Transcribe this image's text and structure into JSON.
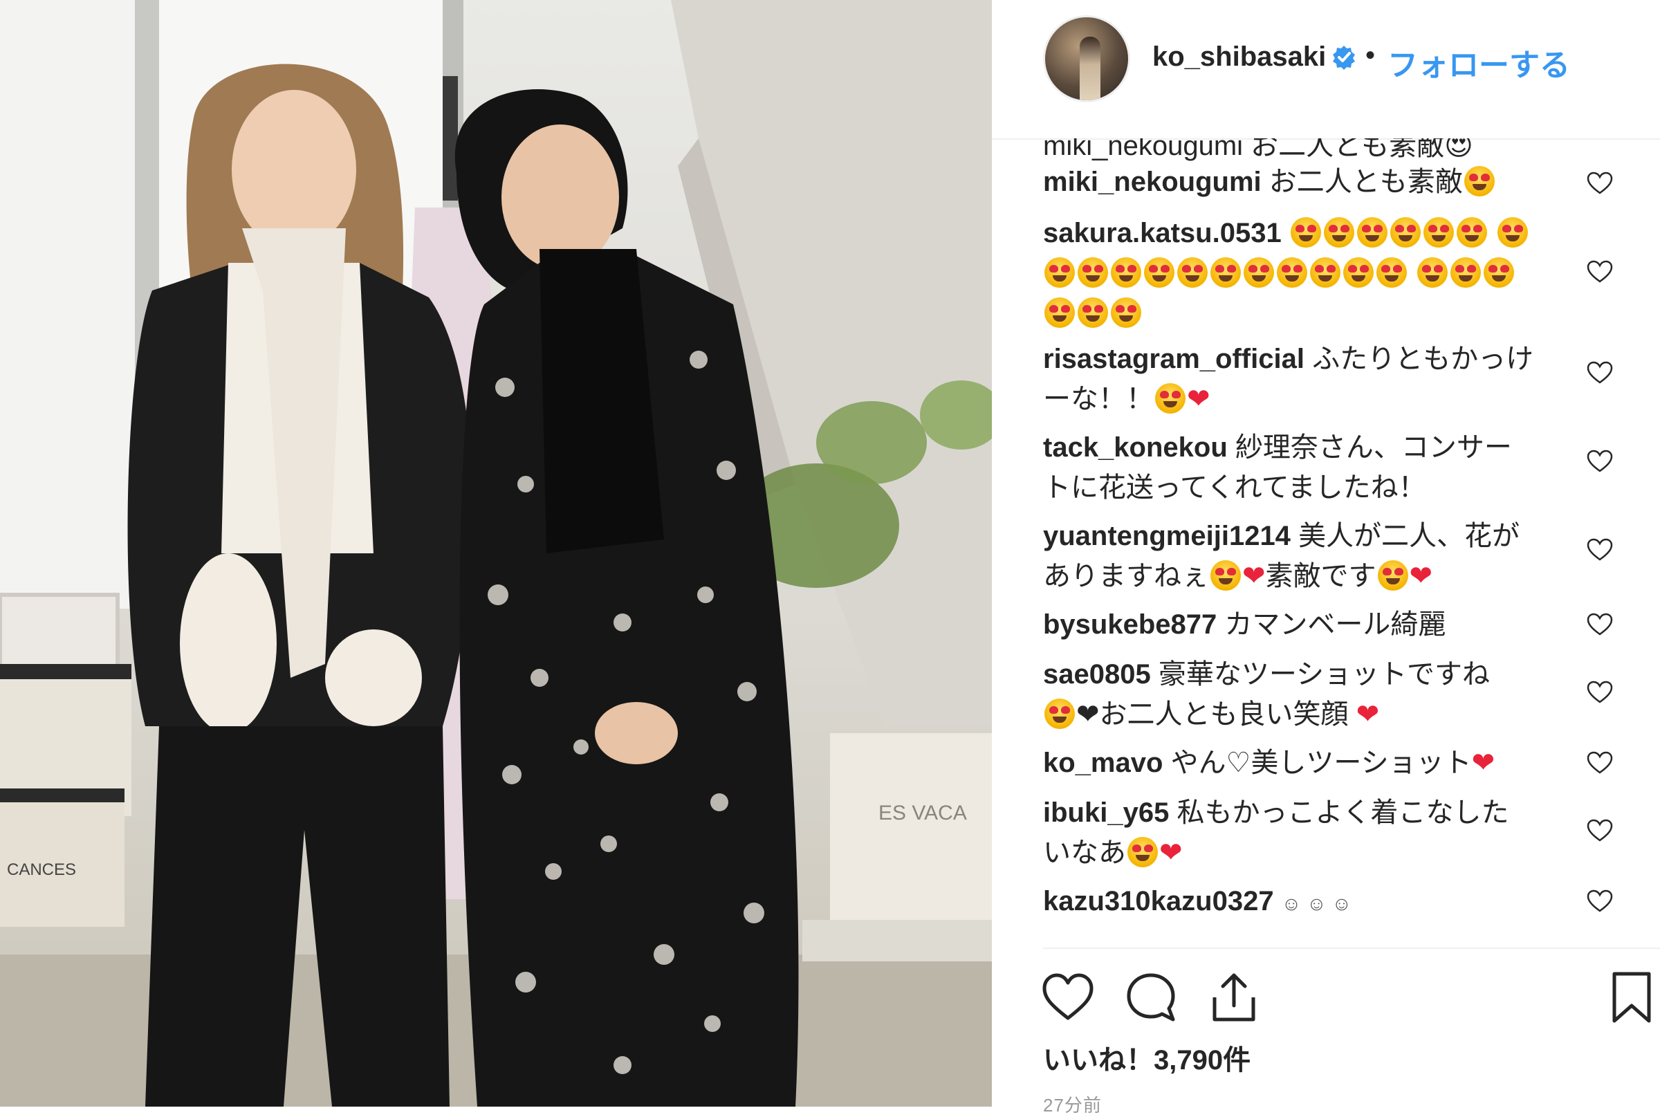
{
  "post": {
    "username": "ko_shibasaki",
    "separator": "•",
    "follow_label": "フォローする",
    "verified_icon": "verified-badge-icon",
    "clipped_comment": "miki_nekougumi お二人とも素敵😍",
    "likes_text": "いいね！3,790件",
    "timestamp": "27分前"
  },
  "comments": [
    {
      "user": "miki_nekougumi",
      "text": "お二人とも素敵"
    },
    {
      "user": "sakura.katsu.0531",
      "text": ""
    },
    {
      "user": "risastagram_official",
      "text": "ふたりともかっけ",
      "text2": "ーな！！"
    },
    {
      "user": "tack_konekou",
      "text": "紗理奈さん、コンサー",
      "text2": "トに花送ってくれてましたね！"
    },
    {
      "user": "yuantengmeiji1214",
      "text": "美人が二人、花が",
      "text2": "ありますねぇ",
      "text3": "素敵です"
    },
    {
      "user": "bysukebe877",
      "text": "カマンベール綺麗"
    },
    {
      "user": "sae0805",
      "text": "豪華なツーショットですね",
      "text2": "❤お二人とも良い笑顔"
    },
    {
      "user": "ko_mavo",
      "text": "やん♡美しツーショット"
    },
    {
      "user": "ibuki_y65",
      "text": "私もかっこよく着こなした",
      "text2": "いなあ"
    },
    {
      "user": "kazu310kazu0327",
      "text": ""
    }
  ],
  "photo": {
    "bag_text_left": "CANCES",
    "bag_text_right": "ES VACA"
  },
  "colors": {
    "link_blue": "#3897f0",
    "text": "#262626",
    "heart_red": "#e8233a"
  },
  "icons": [
    "like-icon",
    "comment-icon",
    "share-icon",
    "bookmark-icon",
    "heart-outline-icon"
  ]
}
